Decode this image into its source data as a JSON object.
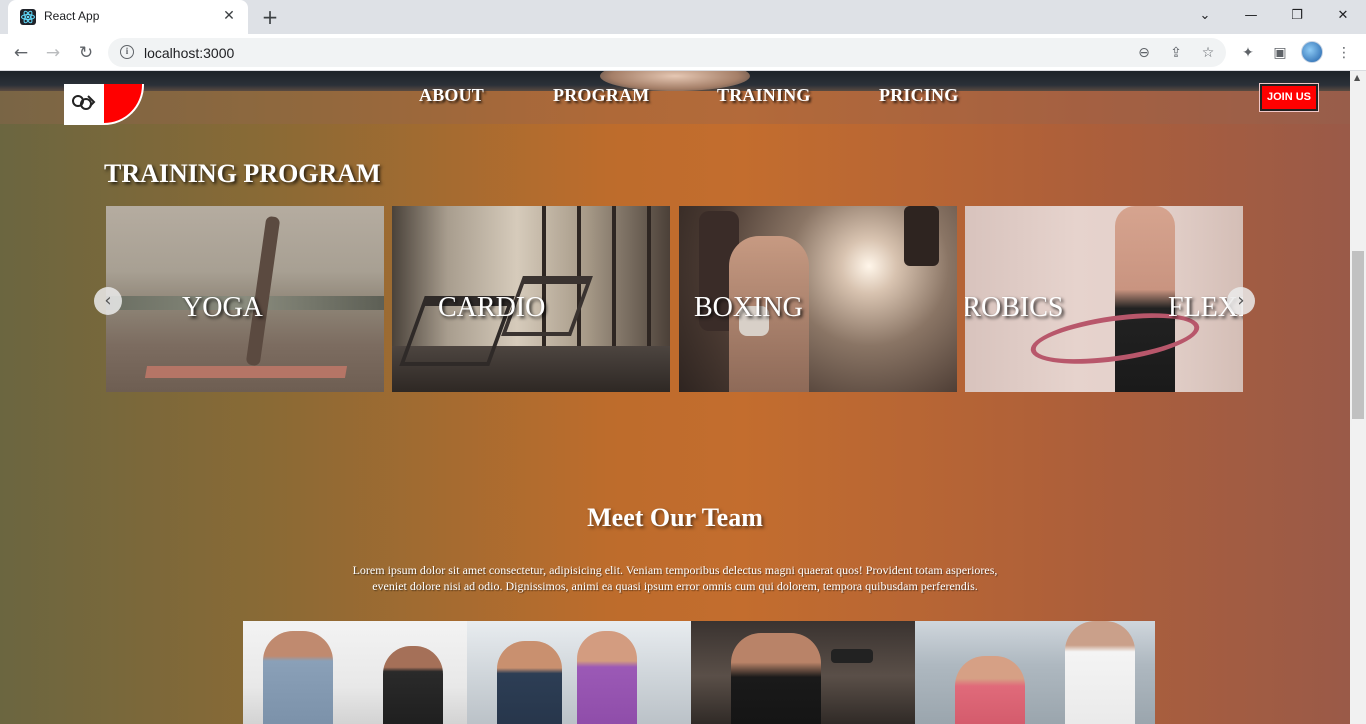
{
  "browser": {
    "tab_title": "React App",
    "tab_close": "✕",
    "new_tab": "+",
    "url": "localhost:3000",
    "window_controls": {
      "minimize": "—",
      "maximize": "❐",
      "close": "✕"
    },
    "chevron": "⌄"
  },
  "nav": {
    "links": [
      "ABOUT",
      "PROGRAM",
      "TRAINING",
      "PRICING"
    ],
    "join_label": "JOIN US"
  },
  "training": {
    "title": "TRAINING PROGRAM",
    "cards": [
      "YOGA",
      "CARDIO",
      "BOXING",
      "AEROBICS",
      "FLEXI"
    ],
    "prev": "‹",
    "next": "›"
  },
  "team": {
    "title": "Meet Our Team",
    "description": "Lorem ipsum dolor sit amet consectetur, adipisicing elit. Veniam temporibus delectus magni quaerat quos! Provident totam asperiores, eveniet dolore nisi ad odio. Dignissimos, animi ea quasi ipsum error omnis cum qui dolorem, tempora quibusdam perferendis."
  },
  "colors": {
    "accent": "#ff0000",
    "page_gradient_mid": "#c36d2e"
  }
}
